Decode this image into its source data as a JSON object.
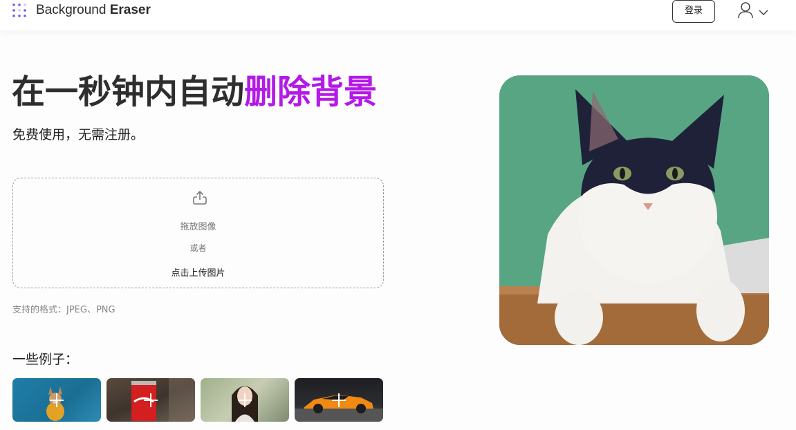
{
  "header": {
    "brand_light": "Background",
    "brand_bold": "Eraser",
    "login_label": "登录",
    "user_icon": "user-icon",
    "dropdown_icon": "chevron-down-icon"
  },
  "hero": {
    "title_main": "在一秒钟内自动",
    "title_highlight": "删除背景",
    "subtitle": "免费使用，无需注册。",
    "highlight_color": "#b319e8"
  },
  "upload": {
    "icon": "upload-icon",
    "drag_text": "拖放图像",
    "or_text": "或者",
    "click_text": "点击上传图片",
    "formats_text": "支持的格式：JPEG、PNG"
  },
  "examples": {
    "label": "一些例子：",
    "items": [
      {
        "subject": "dog"
      },
      {
        "subject": "cola-can"
      },
      {
        "subject": "woman"
      },
      {
        "subject": "car"
      }
    ]
  },
  "preview": {
    "subject": "cat"
  }
}
